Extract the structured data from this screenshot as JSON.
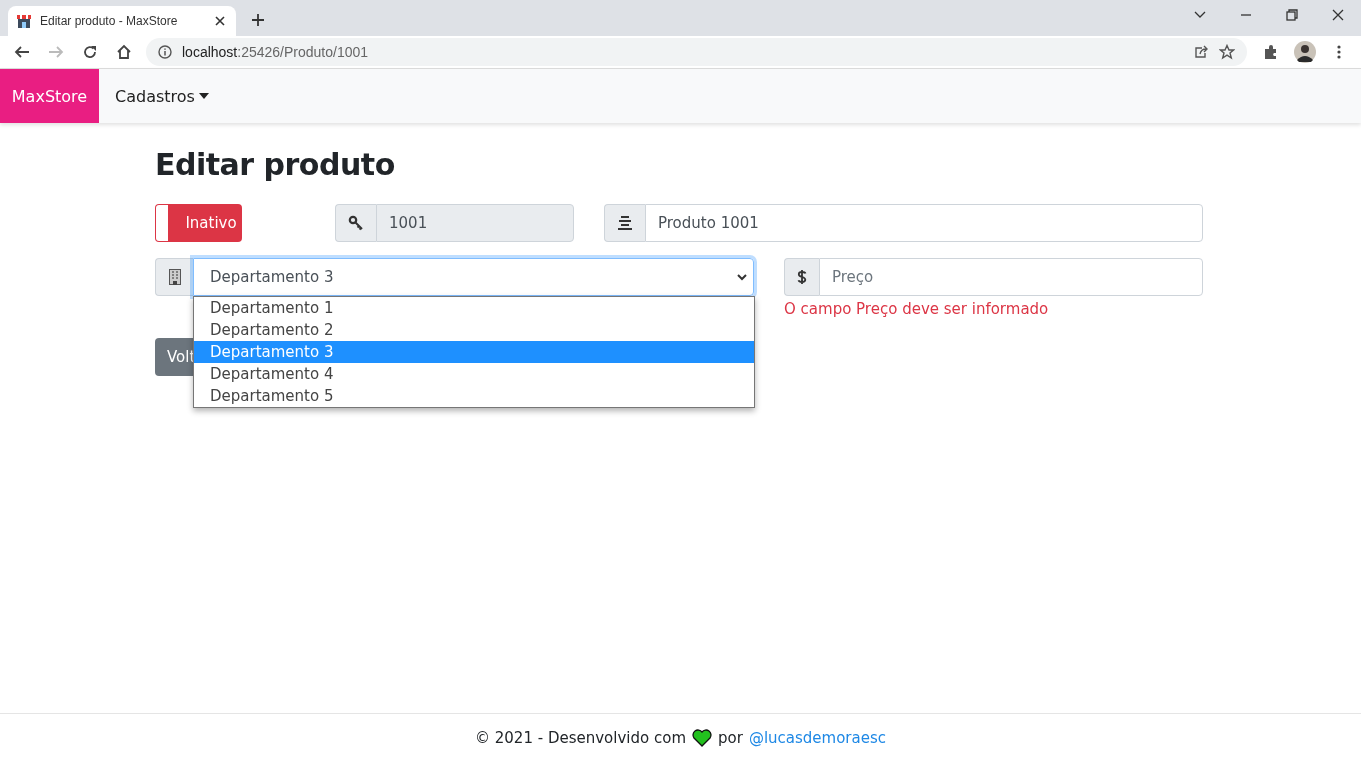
{
  "browser": {
    "tab_title": "Editar produto - MaxStore",
    "url_host": "localhost",
    "url_path": ":25426/Produto/1001"
  },
  "navbar": {
    "brand": "MaxStore",
    "menu": "Cadastros"
  },
  "heading": "Editar produto",
  "form": {
    "status": {
      "label": "Inativo",
      "on": false
    },
    "id": {
      "value": "1001",
      "disabled": true
    },
    "name": {
      "value": "Produto 1001"
    },
    "department": {
      "value": "Departamento 3",
      "expanded": true,
      "options": [
        {
          "label": "Departamento 1",
          "selected": false
        },
        {
          "label": "Departamento 2",
          "selected": false
        },
        {
          "label": "Departamento 3",
          "selected": true
        },
        {
          "label": "Departamento 4",
          "selected": false
        },
        {
          "label": "Departamento 5",
          "selected": false
        }
      ]
    },
    "price": {
      "placeholder": "Preço",
      "error": "O campo Preço deve ser informado"
    },
    "back_button": "Volt"
  },
  "footer": {
    "text": "© 2021 - Desenvolvido com",
    "by": "por",
    "link": "@lucasdemoraesc"
  }
}
